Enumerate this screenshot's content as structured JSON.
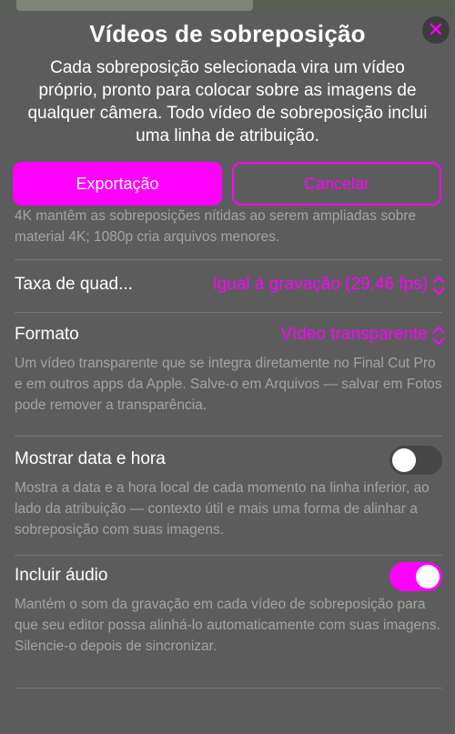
{
  "sheet": {
    "title": "Vídeos de sobreposição",
    "subtitle": "Cada sobreposição selecionada vira um vídeo próprio, pronto para colocar sobre as imagens de qualquer câmera. Todo vídeo de sobreposição inclui uma linha de atribuição.",
    "close_glyph": "✕"
  },
  "actions": {
    "export_label": "Exportação",
    "cancel_label": "Cancelar"
  },
  "resolution": {
    "description_partial": "4K mantêm as sobreposições nítidas ao serem ampliadas sobre material 4K; 1080p cria arquivos menores."
  },
  "frame_rate": {
    "label": "Taxa de quad...",
    "value": "Igual à gravação (29,46 fps)"
  },
  "format": {
    "label": "Formato",
    "value": "Vídeo transparente",
    "description": "Um vídeo transparente que se integra diretamente no Final Cut Pro e em outros apps da Apple. Salve-o em Arquivos — salvar em Fotos pode remover a transparência."
  },
  "show_datetime": {
    "label": "Mostrar data e hora",
    "enabled": false,
    "description": "Mostra a data e a hora local de cada momento na linha inferior, ao lado da atribuição — contexto útil e mais uma forma de alinhar a sobreposição com suas imagens."
  },
  "include_audio": {
    "label": "Incluir áudio",
    "enabled": true,
    "description": "Mantém o som da gravação em cada vídeo de sobreposição para que seu editor possa alinhá-lo automaticamente com suas imagens. Silencie-o depois de sincronizar."
  },
  "colors": {
    "accent": "#ff00ff",
    "sheet_background": "#5c5c5c",
    "secondary_text": "#a4a4a4"
  },
  "icons": {
    "close": "close-icon",
    "stepper": "chevron-up-down-icon"
  }
}
